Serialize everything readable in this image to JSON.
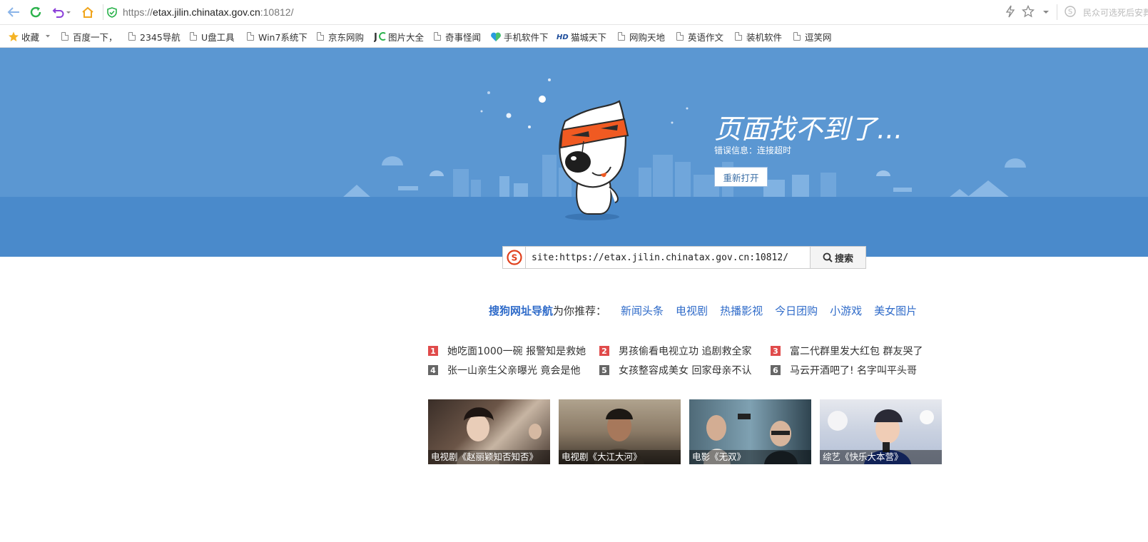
{
  "browser": {
    "url_scheme": "https://",
    "url_host": "etax.jilin.chinatax.gov.cn",
    "url_path": ":10812/",
    "side_text": "民众可选死后安葬"
  },
  "bookmarks": {
    "favorites_label": "收藏",
    "items": [
      {
        "label": "百度一下，"
      },
      {
        "label": "2345导航"
      },
      {
        "label": "U盘工具"
      },
      {
        "label": "Win7系统下"
      },
      {
        "label": "京东网购"
      },
      {
        "label": "图片大全"
      },
      {
        "label": "奇事怪闻"
      },
      {
        "label": "手机软件下"
      },
      {
        "label": "猫城天下"
      },
      {
        "label": "网购天地"
      },
      {
        "label": "英语作文"
      },
      {
        "label": "装机软件"
      },
      {
        "label": "逗笑网"
      }
    ]
  },
  "error": {
    "title": "页面找不到了...",
    "info": "错误信息：连接超时",
    "reopen_label": "重新打开"
  },
  "search": {
    "value": "site:https://etax.jilin.chinatax.gov.cn:10812/",
    "button_label": "搜索"
  },
  "recommend": {
    "brand": "搜狗网址导航",
    "tail": "为你推荐：",
    "links": [
      "新闻头条",
      "电视剧",
      "热播影视",
      "今日团购",
      "小游戏",
      "美女图片"
    ]
  },
  "news": [
    {
      "num": "1",
      "text": "她吃面1000一碗 报警知是救她"
    },
    {
      "num": "2",
      "text": "男孩偷看电视立功 追剧救全家"
    },
    {
      "num": "3",
      "text": "富二代群里发大红包 群友哭了"
    },
    {
      "num": "4",
      "text": "张一山亲生父亲曝光 竟会是他"
    },
    {
      "num": "5",
      "text": "女孩整容成美女 回家母亲不认"
    },
    {
      "num": "6",
      "text": "马云开酒吧了! 名字叫平头哥"
    }
  ],
  "thumbs": [
    {
      "caption": "电视剧《赵丽颖知否知否》"
    },
    {
      "caption": "电视剧《大江大河》"
    },
    {
      "caption": "电影《无双》"
    },
    {
      "caption": "综艺《快乐大本营》"
    }
  ],
  "colors": {
    "sky": "#5b97d2",
    "ground": "#4a8acb",
    "link": "#2f6bc9",
    "hot_badge": "#e04b4b",
    "cold_badge": "#666666"
  }
}
